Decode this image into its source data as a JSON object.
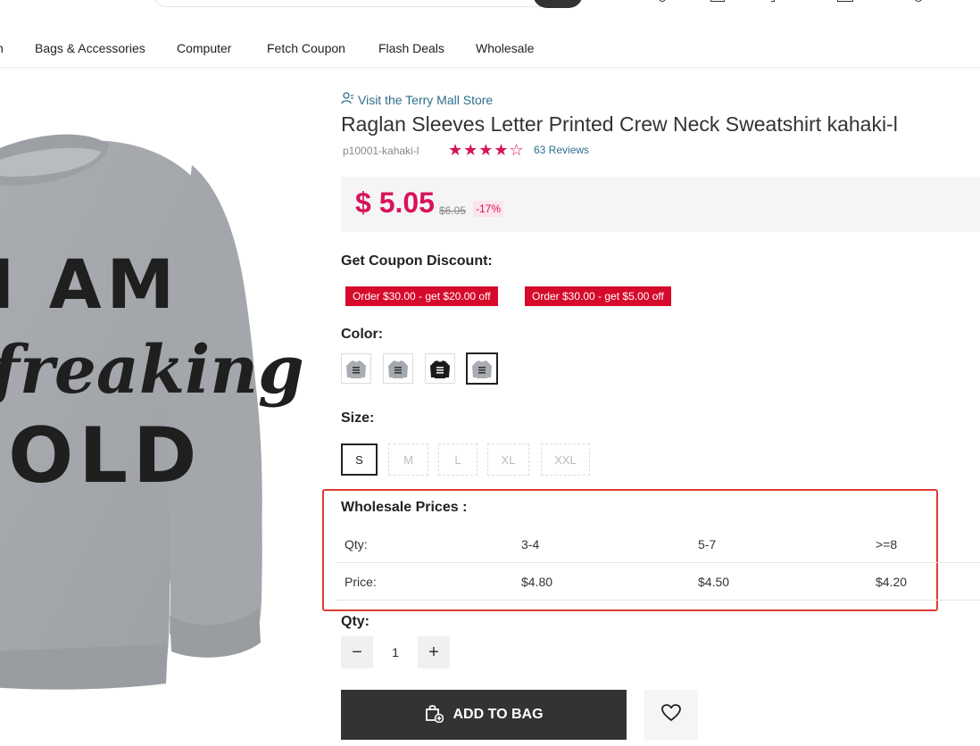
{
  "header": {
    "nav_items": [
      "n",
      "Bags & Accessories",
      "Computer",
      "Fetch Coupon",
      "Flash Deals",
      "Wholesale"
    ]
  },
  "product": {
    "store_link": "Visit the Terry Mall Store",
    "title": "Raglan Sleeves Letter Printed Crew Neck Sweatshirt kahaki-l",
    "sku": "p10001-kahaki-l",
    "rating_stars": "★★★★☆",
    "rating": 4,
    "reviews": "63 Reviews",
    "price": "$ 5.05",
    "old_price": "$6.05",
    "discount": "-17%",
    "image_text": [
      "I AM",
      "freaking",
      "COLD"
    ]
  },
  "coupon": {
    "label": "Get Coupon Discount:",
    "items": [
      "Order $30.00 - get $20.00 off",
      "Order $30.00 - get $5.00 off"
    ]
  },
  "color": {
    "label": "Color:",
    "swatches": [
      {
        "name": "light-gray",
        "shirt": "#a9adb3",
        "print": "#333",
        "selected": false
      },
      {
        "name": "gray",
        "shirt": "#a4a9b0",
        "print": "#333",
        "selected": false
      },
      {
        "name": "black",
        "shirt": "#1b1b1b",
        "print": "#eee",
        "selected": false
      },
      {
        "name": "kahaki",
        "shirt": "#a9adb3",
        "print": "#333",
        "selected": true
      }
    ]
  },
  "size": {
    "label": "Size:",
    "options": [
      "S",
      "M",
      "L",
      "XL",
      "XXL"
    ],
    "selected": "S"
  },
  "wholesale": {
    "title": "Wholesale Prices :",
    "qty_label": "Qty:",
    "price_label": "Price:",
    "tiers": [
      {
        "qty": "3-4",
        "price": "$4.80"
      },
      {
        "qty": "5-7",
        "price": "$4.50"
      },
      {
        "qty": ">=8",
        "price": "$4.20"
      }
    ]
  },
  "quantity": {
    "label": "Qty:",
    "value": "1",
    "minus": "−",
    "plus": "+"
  },
  "actions": {
    "add_to_bag": "ADD TO BAG"
  },
  "colors": {
    "accent": "#d8125b",
    "coupon_red": "#d60a2a",
    "link": "#2e6f8d",
    "dark_button": "#333333",
    "highlight_frame": "#e03b31"
  }
}
